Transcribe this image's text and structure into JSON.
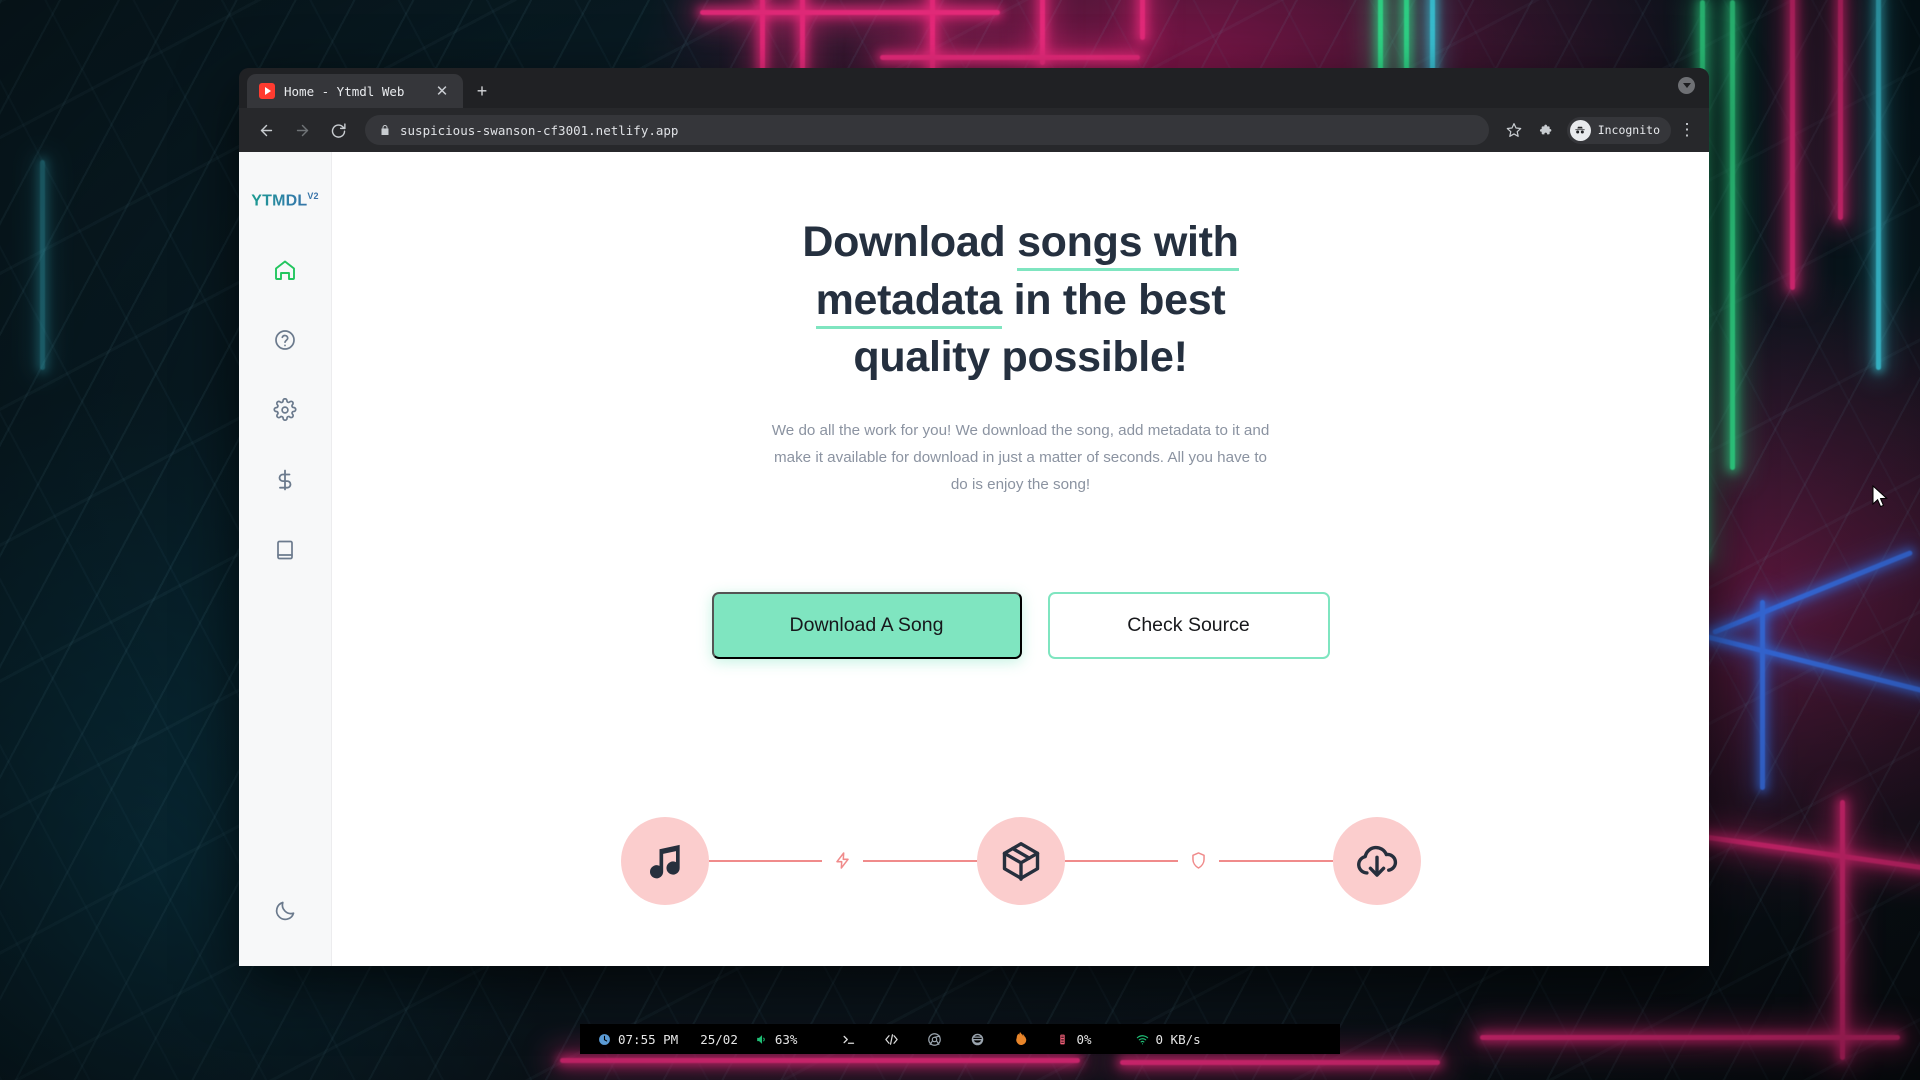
{
  "browser": {
    "tab": {
      "title": "Home - Ytmdl Web",
      "favicon_icon": "youtube-play-icon",
      "close_icon": "close-icon"
    },
    "new_tab_label": "+",
    "window_control_icon": "caret-down-icon",
    "toolbar": {
      "back_icon": "arrow-left-icon",
      "forward_icon": "arrow-right-icon",
      "reload_icon": "reload-icon",
      "lock_icon": "lock-icon",
      "url": "suspicious-swanson-cf3001.netlify.app",
      "bookmark_icon": "star-icon",
      "extensions_icon": "puzzle-icon",
      "profile_icon": "incognito-icon",
      "profile_label": "Incognito",
      "menu_icon": "three-dot-menu-icon"
    }
  },
  "app": {
    "brand": {
      "name": "YTMDL",
      "version": "V2"
    },
    "sidebar": {
      "items": [
        {
          "label": "Home",
          "icon": "home-icon",
          "active": true
        },
        {
          "label": "Help",
          "icon": "question-circle-icon",
          "active": false
        },
        {
          "label": "Settings",
          "icon": "gear-icon",
          "active": false
        },
        {
          "label": "Donate",
          "icon": "dollar-icon",
          "active": false
        },
        {
          "label": "Docs",
          "icon": "book-icon",
          "active": false
        }
      ],
      "theme_toggle": {
        "label": "Dark mode",
        "icon": "moon-icon"
      }
    },
    "hero": {
      "heading_part_1": "Download ",
      "heading_highlight": "songs with metadata",
      "heading_part_2": " in the best quality possible!",
      "subtitle": "We do all the work for you! We download the song, add metadata to it and make it available for download in just a matter of seconds. All you have to do is enjoy the song!",
      "primary_button": "Download A Song",
      "secondary_button": "Check Source"
    },
    "features": [
      {
        "icon": "music-note-icon",
        "label": "Song"
      },
      {
        "icon": "lightning-bolt-icon",
        "label": "Fast"
      },
      {
        "icon": "package-box-icon",
        "label": "Metadata"
      },
      {
        "icon": "shield-icon",
        "label": "Secure"
      },
      {
        "icon": "cloud-download-icon",
        "label": "Download"
      }
    ]
  },
  "colors": {
    "accent_green": "#7FE5C0",
    "heading": "#25303f",
    "subtitle": "#8b93a1",
    "feature_circle": "#fbcdcd",
    "connector": "#f08b8b",
    "sidebar_active": "#22c55e"
  },
  "taskbar": {
    "clock_icon": "clock-icon",
    "time": "07:55 PM",
    "date": "25/02",
    "volume_icon": "speaker-icon",
    "volume": "63%",
    "terminal_icon": "terminal-prompt-icon",
    "code_icon": "code-brackets-icon",
    "chrome_icon": "chrome-icon",
    "disc_icon": "disc-icon",
    "firefox_icon": "firefox-icon",
    "cpu_icon": "cpu-icon",
    "cpu": "0%",
    "wifi_icon": "wifi-icon",
    "network": "0 KB/s"
  }
}
